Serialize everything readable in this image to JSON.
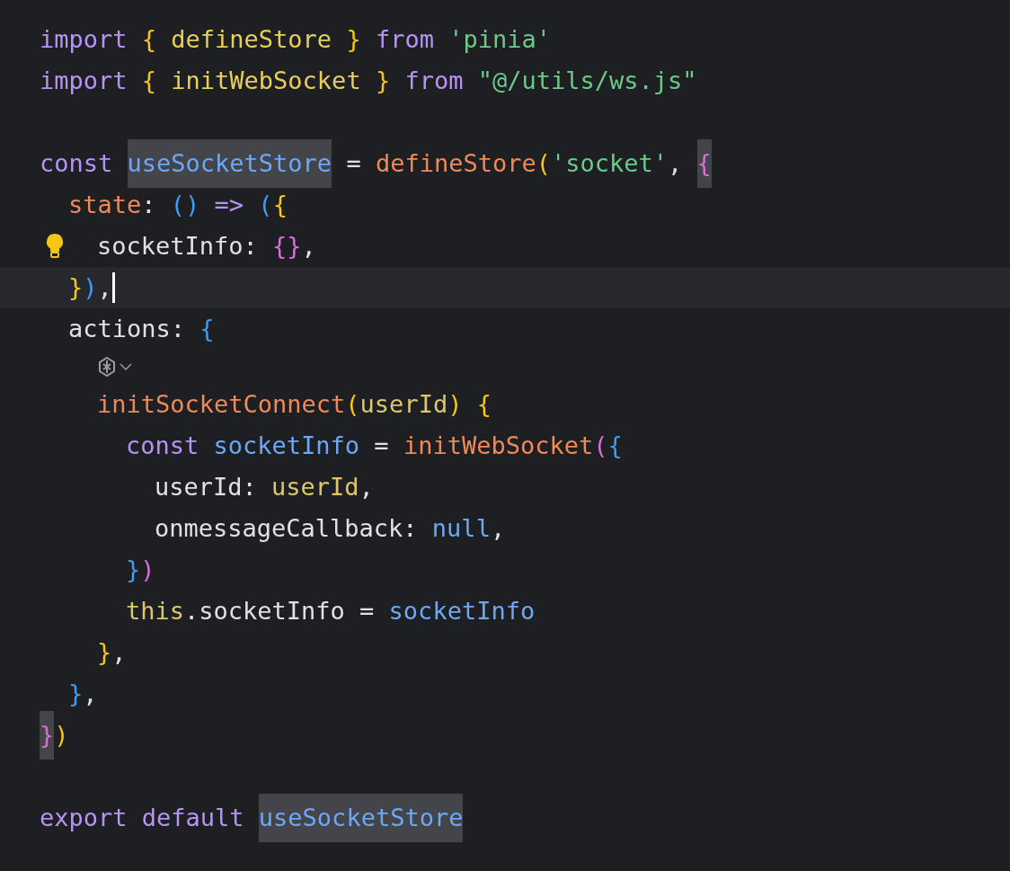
{
  "editor": {
    "lines": [
      {
        "kind": "code",
        "tokens": [
          {
            "text": "import ",
            "kind": "keyword"
          },
          {
            "text": "{ ",
            "kind": "brace-gold"
          },
          {
            "text": "defineStore ",
            "kind": "import-name"
          },
          {
            "text": "} ",
            "kind": "brace-gold"
          },
          {
            "text": "from ",
            "kind": "keyword"
          },
          {
            "text": "'pinia'",
            "kind": "string"
          }
        ]
      },
      {
        "kind": "code",
        "tokens": [
          {
            "text": "import ",
            "kind": "keyword"
          },
          {
            "text": "{ ",
            "kind": "brace-gold"
          },
          {
            "text": "initWebSocket ",
            "kind": "import-name"
          },
          {
            "text": "} ",
            "kind": "brace-gold"
          },
          {
            "text": "from ",
            "kind": "keyword"
          },
          {
            "text": "\"@/utils/ws.js\"",
            "kind": "string"
          }
        ]
      },
      {
        "kind": "blank"
      },
      {
        "kind": "code",
        "tokens": [
          {
            "text": "const ",
            "kind": "keyword"
          },
          {
            "text": "useSocketStore",
            "kind": "variable",
            "highlighted": true
          },
          {
            "text": " = ",
            "kind": "plain"
          },
          {
            "text": "defineStore",
            "kind": "function"
          },
          {
            "text": "(",
            "kind": "brace-gold"
          },
          {
            "text": "'socket'",
            "kind": "string"
          },
          {
            "text": ", ",
            "kind": "plain"
          },
          {
            "text": "{",
            "kind": "brace-pink",
            "highlighted": true
          }
        ],
        "children": [
          {
            "kind": "code",
            "tokens": [
              {
                "text": "state",
                "kind": "function"
              },
              {
                "text": ": ",
                "kind": "plain"
              },
              {
                "text": "() ",
                "kind": "brace-blue"
              },
              {
                "text": "=> ",
                "kind": "keyword"
              },
              {
                "text": "(",
                "kind": "brace-blue"
              },
              {
                "text": "{",
                "kind": "brace-gold"
              }
            ],
            "children": [
              {
                "kind": "code",
                "bulb": true,
                "tokens": [
                  {
                    "text": "socketInfo",
                    "kind": "plain"
                  },
                  {
                    "text": ": ",
                    "kind": "plain"
                  },
                  {
                    "text": "{}",
                    "kind": "brace-pink"
                  },
                  {
                    "text": ",",
                    "kind": "plain"
                  }
                ]
              }
            ]
          },
          {
            "kind": "code",
            "current": true,
            "tokens": [
              {
                "text": "}",
                "kind": "brace-gold"
              },
              {
                "text": ")",
                "kind": "brace-blue"
              },
              {
                "text": ",",
                "kind": "plain"
              }
            ]
          },
          {
            "kind": "code",
            "tokens": [
              {
                "text": "actions",
                "kind": "plain"
              },
              {
                "text": ": ",
                "kind": "plain"
              },
              {
                "text": "{",
                "kind": "brace-blue"
              }
            ],
            "children": [
              {
                "kind": "inlay"
              },
              {
                "kind": "code",
                "tokens": [
                  {
                    "text": "initSocketConnect",
                    "kind": "function"
                  },
                  {
                    "text": "(",
                    "kind": "brace-gold"
                  },
                  {
                    "text": "userId",
                    "kind": "param"
                  },
                  {
                    "text": ") ",
                    "kind": "brace-gold"
                  },
                  {
                    "text": "{",
                    "kind": "brace-gold"
                  }
                ],
                "children": [
                  {
                    "kind": "code",
                    "tokens": [
                      {
                        "text": "const ",
                        "kind": "keyword"
                      },
                      {
                        "text": "socketInfo",
                        "kind": "variable"
                      },
                      {
                        "text": " = ",
                        "kind": "plain"
                      },
                      {
                        "text": "initWebSocket",
                        "kind": "function"
                      },
                      {
                        "text": "(",
                        "kind": "brace-pink"
                      },
                      {
                        "text": "{",
                        "kind": "brace-blue"
                      }
                    ],
                    "children": [
                      {
                        "kind": "code",
                        "tokens": [
                          {
                            "text": "userId",
                            "kind": "plain"
                          },
                          {
                            "text": ": ",
                            "kind": "plain"
                          },
                          {
                            "text": "userId",
                            "kind": "param"
                          },
                          {
                            "text": ",",
                            "kind": "plain"
                          }
                        ]
                      },
                      {
                        "kind": "code",
                        "tokens": [
                          {
                            "text": "onmessageCallback",
                            "kind": "plain"
                          },
                          {
                            "text": ": ",
                            "kind": "plain"
                          },
                          {
                            "text": "null",
                            "kind": "variable"
                          },
                          {
                            "text": ",",
                            "kind": "plain"
                          }
                        ]
                      }
                    ]
                  },
                  {
                    "kind": "code",
                    "tokens": [
                      {
                        "text": "}",
                        "kind": "brace-blue"
                      },
                      {
                        "text": ")",
                        "kind": "brace-pink"
                      }
                    ]
                  },
                  {
                    "kind": "code",
                    "tokens": [
                      {
                        "text": "this",
                        "kind": "param"
                      },
                      {
                        "text": ".socketInfo = ",
                        "kind": "plain"
                      },
                      {
                        "text": "socketInfo",
                        "kind": "variable"
                      }
                    ]
                  }
                ]
              },
              {
                "kind": "code",
                "tokens": [
                  {
                    "text": "}",
                    "kind": "brace-gold"
                  },
                  {
                    "text": ",",
                    "kind": "plain"
                  }
                ]
              }
            ]
          },
          {
            "kind": "code",
            "tokens": [
              {
                "text": "}",
                "kind": "brace-blue"
              },
              {
                "text": ",",
                "kind": "plain"
              }
            ]
          }
        ]
      },
      {
        "kind": "code",
        "tokens": [
          {
            "text": "}",
            "kind": "brace-pink",
            "highlighted": true
          },
          {
            "text": ")",
            "kind": "brace-gold"
          }
        ]
      },
      {
        "kind": "blank"
      },
      {
        "kind": "code",
        "tokens": [
          {
            "text": "export ",
            "kind": "keyword"
          },
          {
            "text": "default ",
            "kind": "keyword"
          },
          {
            "text": "useSocketStore",
            "kind": "variable",
            "highlighted": true
          }
        ]
      }
    ]
  }
}
